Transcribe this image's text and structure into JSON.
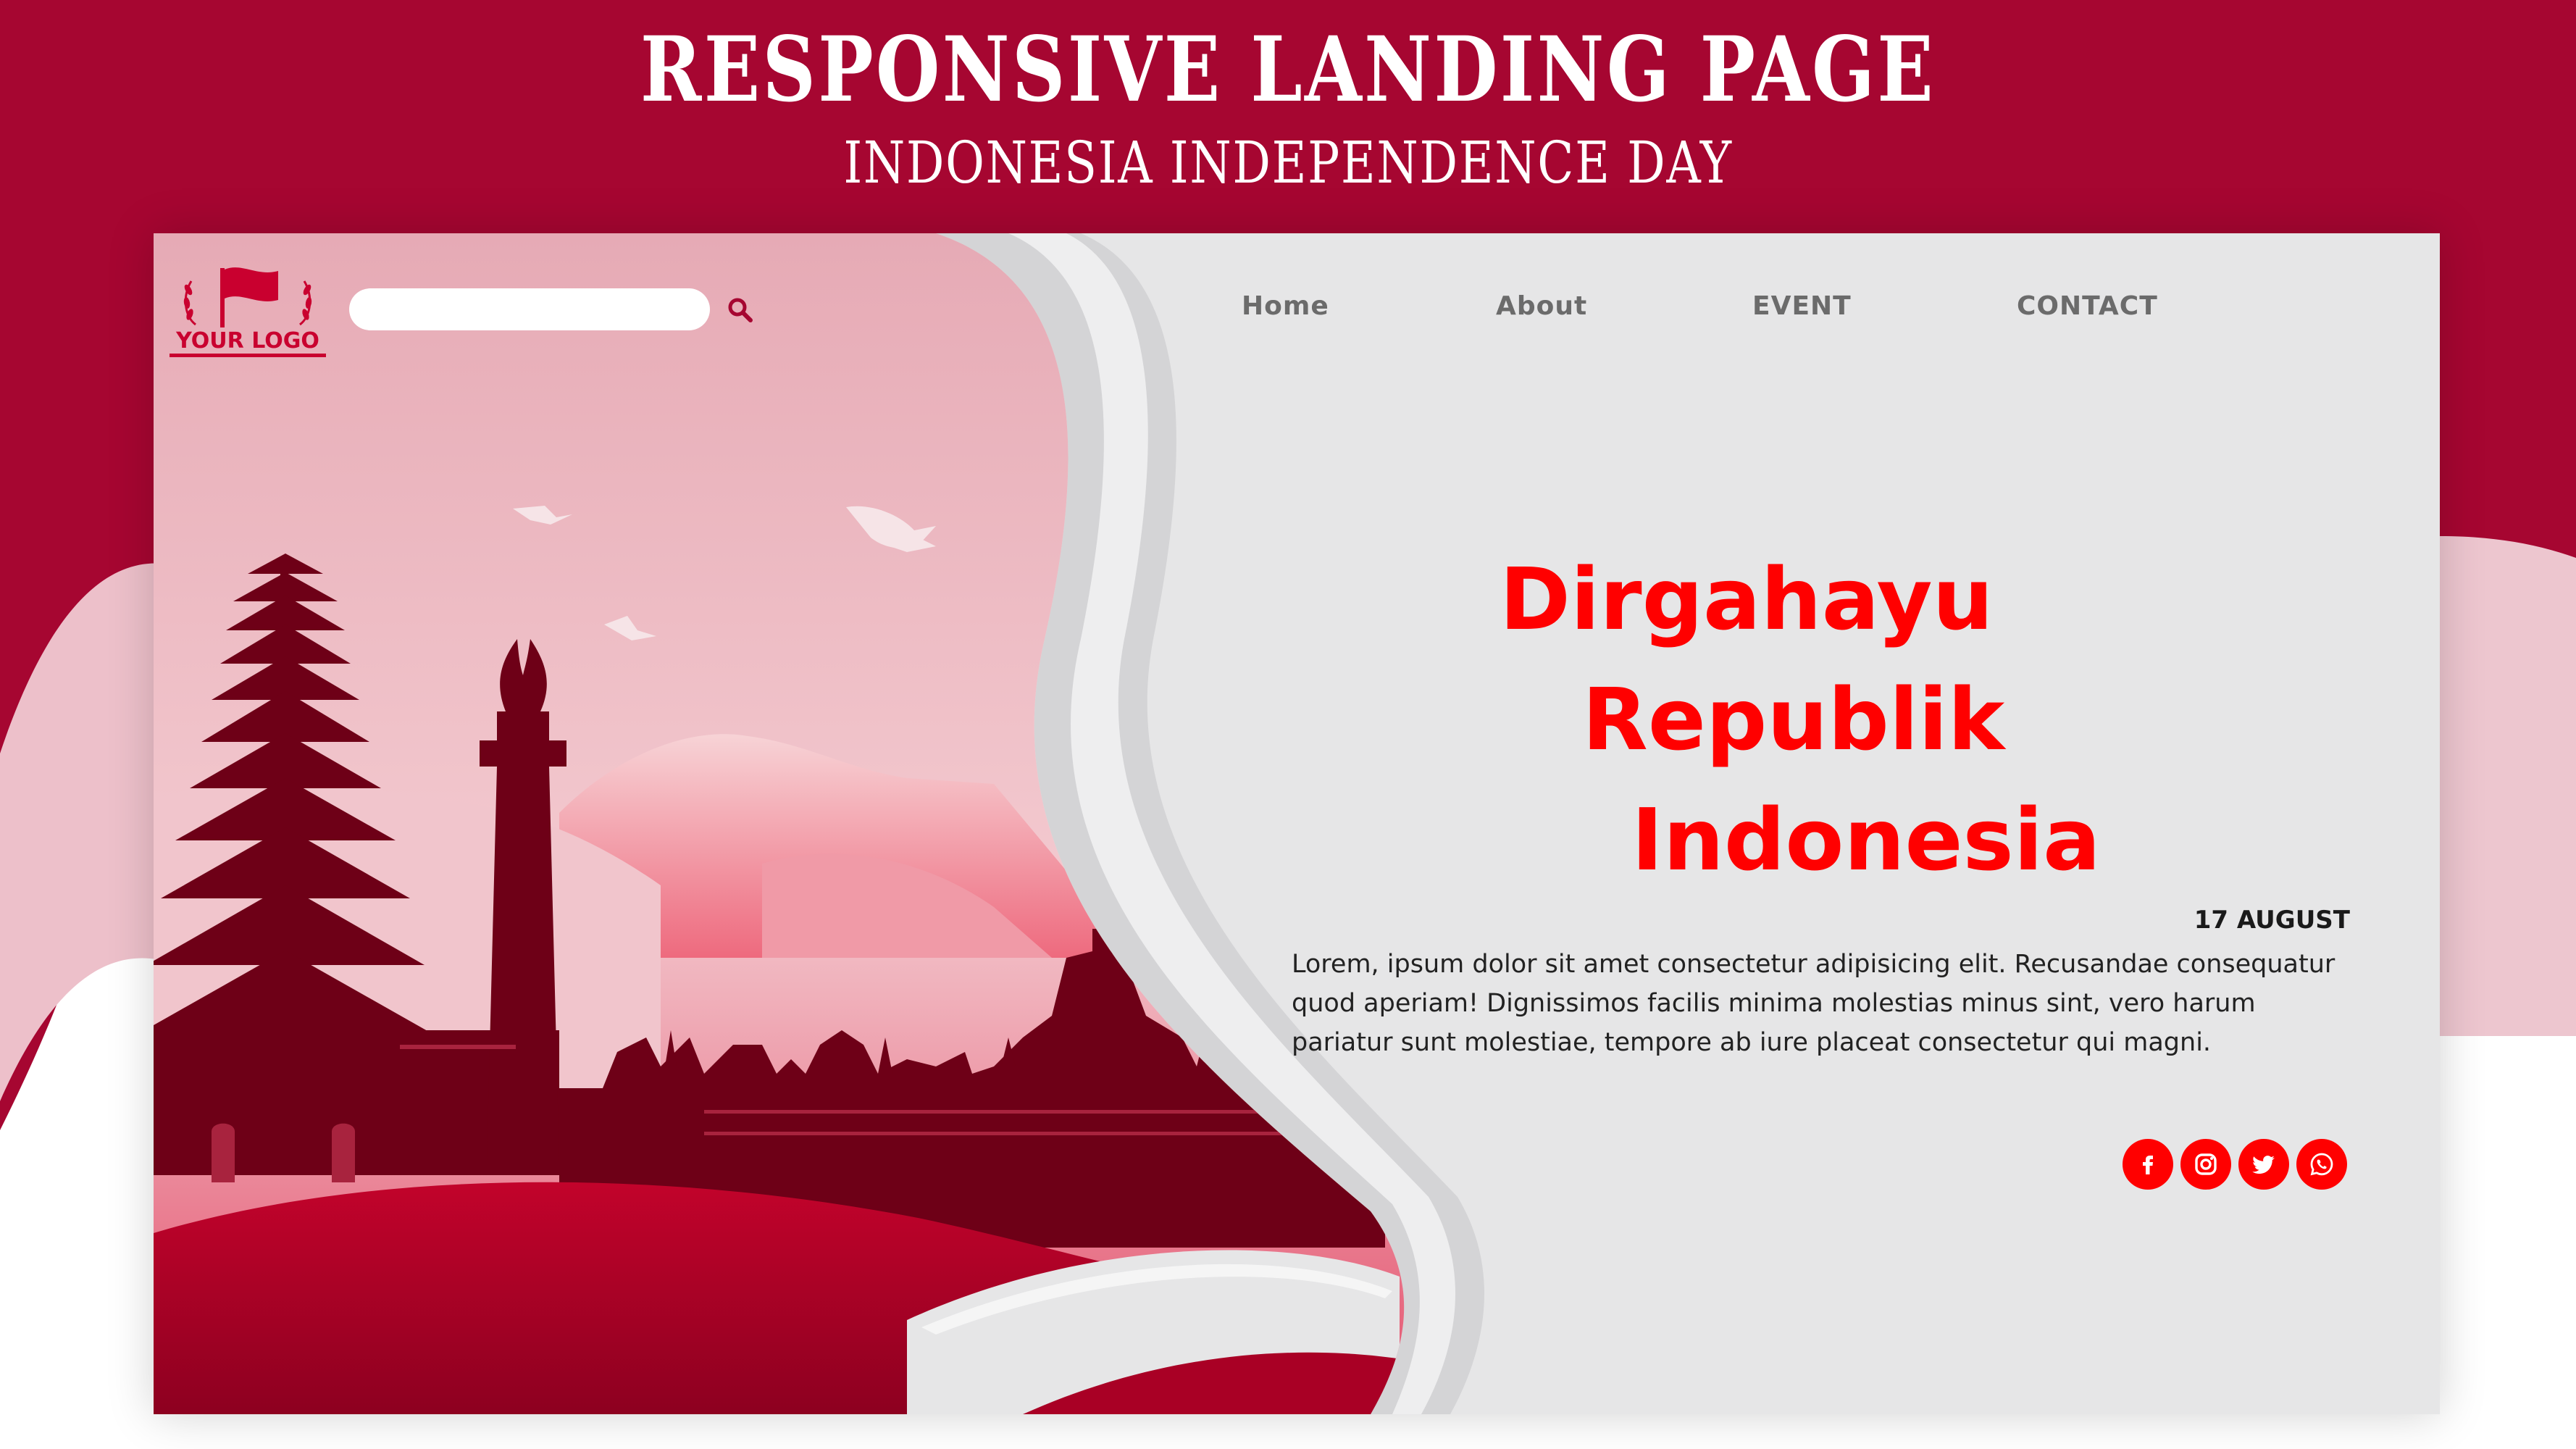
{
  "banner": {
    "title": "RESPONSIVE LANDING PAGE",
    "subtitle": "INDONESIA INDEPENDENCE DAY"
  },
  "logo": {
    "text": "YOUR LOGO"
  },
  "search": {
    "placeholder": "",
    "value": "",
    "icon": "search-icon"
  },
  "nav": {
    "items": [
      {
        "label": "Home"
      },
      {
        "label": "About"
      },
      {
        "label": "EVENT"
      },
      {
        "label": "CONTACT"
      }
    ]
  },
  "hero": {
    "lines": [
      "Dirgahayu",
      "Republik",
      "Indonesia"
    ],
    "date": "17 AUGUST",
    "body": "Lorem, ipsum dolor sit amet consectetur adipisicing elit. Recusandae consequatur quod aperiam! Dignissimos facilis minima molestias minus sint, vero harum pariatur sunt molestiae, tempore ab iure placeat consectetur qui magni."
  },
  "social": [
    {
      "icon": "facebook-icon"
    },
    {
      "icon": "instagram-icon"
    },
    {
      "icon": "twitter-icon"
    },
    {
      "icon": "whatsapp-icon"
    }
  ],
  "colors": {
    "banner_red": "#a60631",
    "accent_red": "#ff0000",
    "card_bg": "#e6e6e7",
    "silhouette": "#6e0017",
    "pink": "#e9b7c1"
  }
}
